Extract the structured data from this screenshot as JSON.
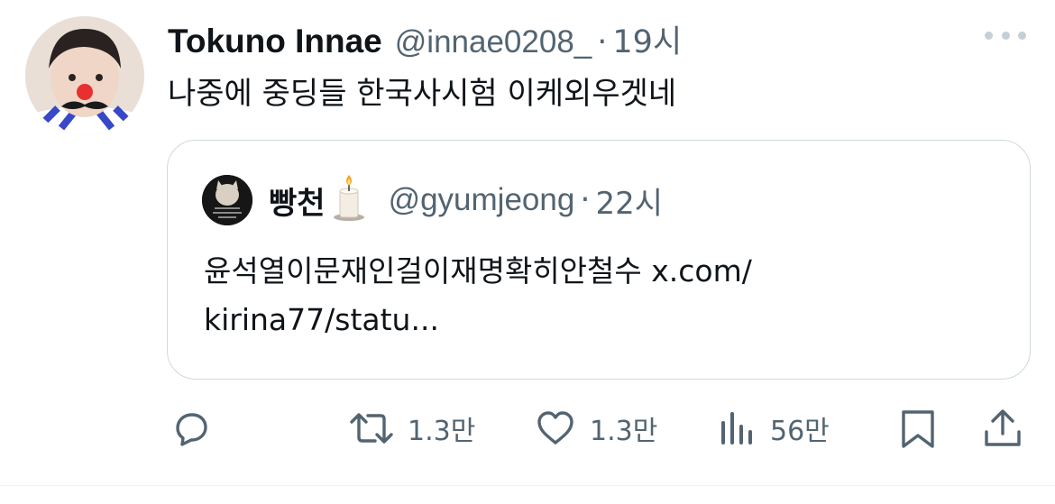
{
  "tweet": {
    "display_name": "Tokuno Innae",
    "handle": "@innae0208_",
    "separator": "·",
    "time": "19시",
    "text": "나중에 중딩들 한국사시험 이케외우겟네"
  },
  "quote": {
    "display_name": "빵천",
    "name_emoji": "candle-icon",
    "handle": "@gyumjeong",
    "separator": "·",
    "time": "22시",
    "text_line1": "윤석열이문재인걸이재명확히안철수 x.com/",
    "text_line2": "kirina77/statu..."
  },
  "actions": {
    "reply_icon": "reply-icon",
    "retweet_count": "1.3만",
    "like_count": "1.3만",
    "views_count": "56만",
    "bookmark_icon": "bookmark-icon",
    "share_icon": "share-icon"
  },
  "colors": {
    "text_primary": "#0f1419",
    "text_secondary": "#536471",
    "border": "#cfd9de"
  }
}
